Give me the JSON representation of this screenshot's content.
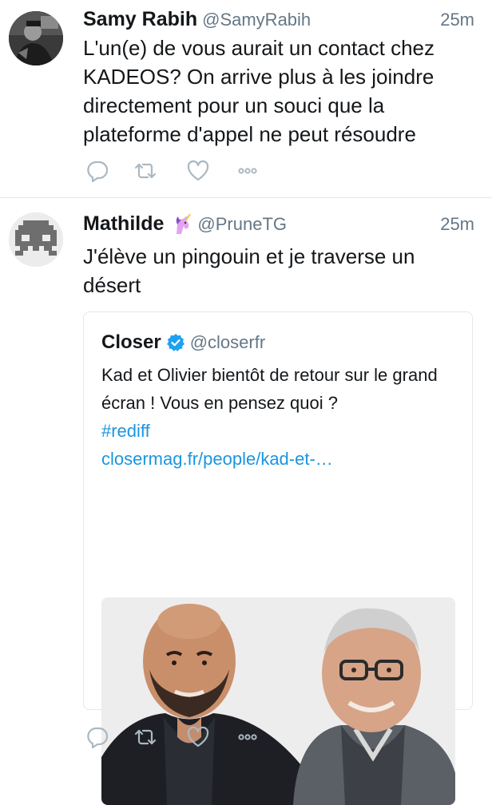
{
  "tweets": [
    {
      "name": "Samy Rabih",
      "handle": "@SamyRabih",
      "time": "25m",
      "text": "L'un(e) de vous aurait un contact chez KADEOS? On arrive plus à les joindre directement pour un souci que la plateforme d'appel ne peut résoudre",
      "avatar": "person-photo"
    },
    {
      "name": "Mathilde",
      "name_emoji": "unicorn-icon",
      "handle": "@PruneTG",
      "time": "25m",
      "text": "J'élève un pingouin et je traverse un désert",
      "avatar": "space-invader",
      "quote": {
        "name": "Closer",
        "verified": true,
        "handle": "@closerfr",
        "text": "Kad et Olivier bientôt de retour sur le grand écran ! Vous en pensez quoi ?",
        "hashtag": "#rediff",
        "link": "closermag.fr/people/kad-et-…",
        "image": "photo-two-men"
      }
    }
  ],
  "actions": [
    "reply-icon",
    "retweet-icon",
    "like-icon",
    "more-icon"
  ],
  "colors": {
    "icon": "#aab8c2",
    "link": "#1b95e0",
    "verified": "#1da1f2",
    "secondary": "#657786",
    "border": "#e1e8ed"
  }
}
